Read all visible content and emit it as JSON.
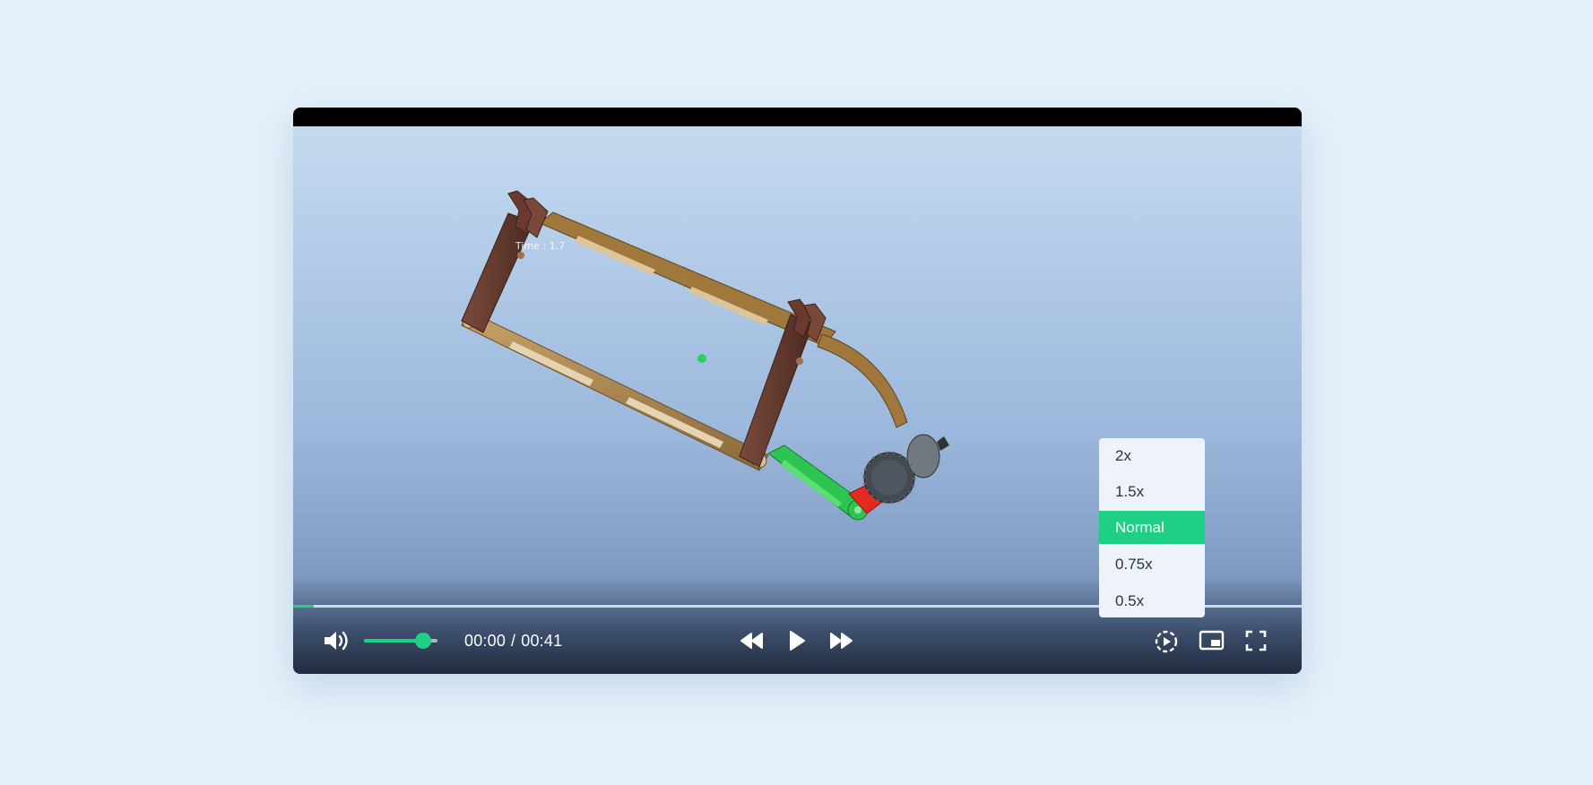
{
  "video": {
    "overlay_text": "Time : 1.7",
    "current_time": "00:00",
    "time_separator": "/",
    "duration": "00:41",
    "progress_fraction": 0.02
  },
  "controls": {
    "volume_level": 0.8,
    "icons": {
      "volume": "volume-icon",
      "rewind": "rewind-icon",
      "play": "play-icon",
      "forward": "fast-forward-icon",
      "speed": "playback-speed-icon",
      "pip": "picture-in-picture-icon",
      "fullscreen": "fullscreen-icon"
    }
  },
  "speed_menu": {
    "options": [
      "2x",
      "1.5x",
      "Normal",
      "0.75x",
      "0.5x"
    ],
    "selected": "Normal"
  },
  "colors": {
    "accent": "#1ed085",
    "page_background": "#e3f0fb",
    "player_letterbox": "#000000"
  }
}
